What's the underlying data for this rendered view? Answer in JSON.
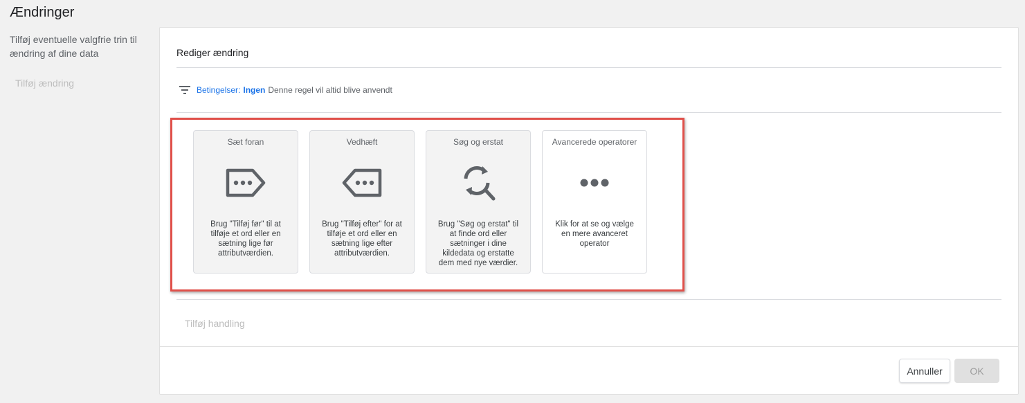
{
  "page": {
    "title": "Ændringer",
    "description": "Tilføj eventuelle valgfrie trin til ændring af dine data",
    "add_change_label": "Tilføj ændring"
  },
  "panel": {
    "title": "Rediger ændring",
    "conditions": {
      "label": "Betingelser:",
      "value": "Ingen",
      "description": "Denne regel vil altid blive anvendt"
    },
    "cards": [
      {
        "title": "Sæt foran",
        "icon": "prepend-tag-icon",
        "description": "Brug \"Tilføj før\" til at tilføje et ord eller en sætning lige før attributværdien."
      },
      {
        "title": "Vedhæft",
        "icon": "append-tag-icon",
        "description": "Brug \"Tilføj efter\" for at tilføje et ord eller en sætning lige efter attributværdien."
      },
      {
        "title": "Søg og erstat",
        "icon": "find-replace-icon",
        "description": "Brug \"Søg og erstat\" til at finde ord eller sætninger i dine kildedata og erstatte dem med nye værdier."
      },
      {
        "title": "Avancerede operatorer",
        "icon": "more-dots-icon",
        "description": "Klik for at se og vælge en mere avanceret operator"
      }
    ],
    "add_action_label": "Tilføj handling"
  },
  "footer": {
    "cancel_label": "Annuller",
    "ok_label": "OK"
  },
  "colors": {
    "accent": "#1a73e8",
    "highlight": "#e0504a",
    "icon": "#5f6368"
  }
}
